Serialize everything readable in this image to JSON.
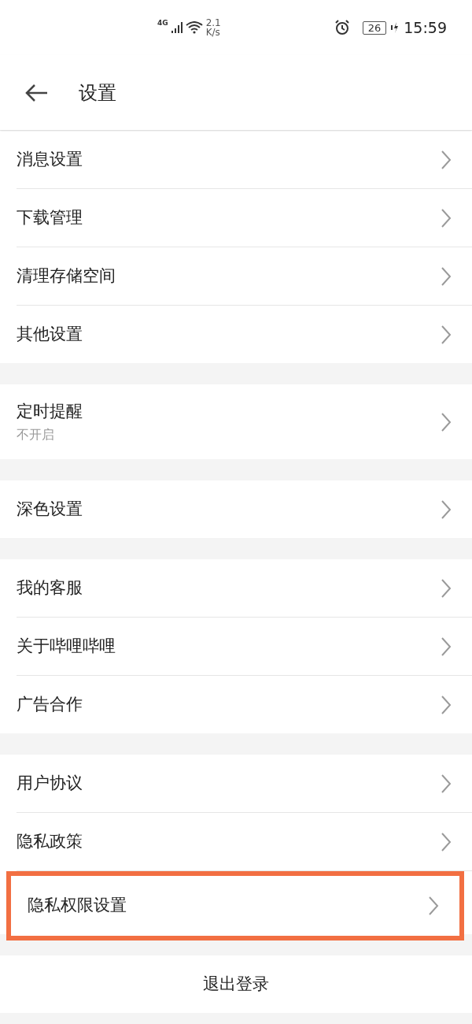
{
  "status_bar": {
    "network": "4G",
    "speed_value": "2.1",
    "speed_unit": "K/s",
    "battery": "26",
    "time": "15:59"
  },
  "header": {
    "title": "设置"
  },
  "groups": [
    {
      "items": [
        {
          "label": "消息设置",
          "highlighted": false
        },
        {
          "label": "下载管理",
          "highlighted": false
        },
        {
          "label": "清理存储空间",
          "highlighted": false
        },
        {
          "label": "其他设置",
          "highlighted": false
        }
      ]
    },
    {
      "items": [
        {
          "label": "定时提醒",
          "subtitle": "不开启",
          "highlighted": false
        }
      ]
    },
    {
      "items": [
        {
          "label": "深色设置",
          "highlighted": false
        }
      ]
    },
    {
      "items": [
        {
          "label": "我的客服",
          "highlighted": false
        },
        {
          "label": "关于哔哩哔哩",
          "highlighted": false
        },
        {
          "label": "广告合作",
          "highlighted": false
        }
      ]
    },
    {
      "items": [
        {
          "label": "用户协议",
          "highlighted": false
        },
        {
          "label": "隐私政策",
          "highlighted": false
        },
        {
          "label": "隐私权限设置",
          "highlighted": true
        }
      ]
    }
  ],
  "logout_button": "退出登录"
}
